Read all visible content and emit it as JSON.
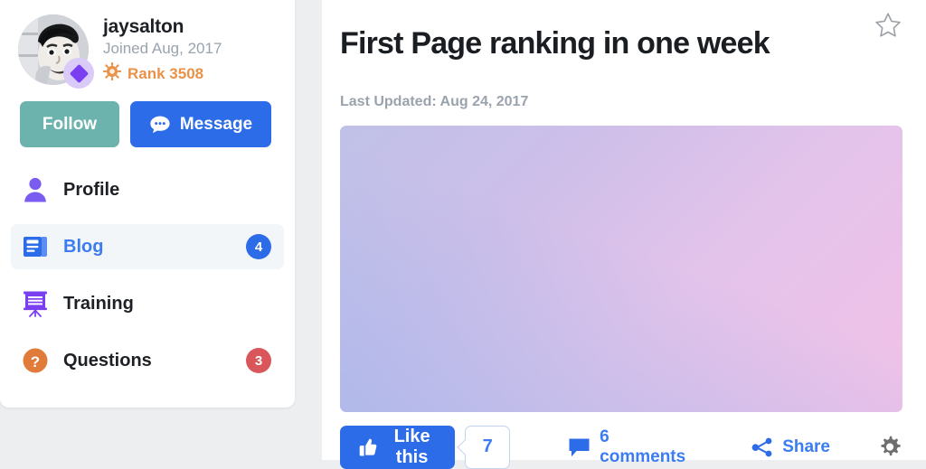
{
  "theme": {
    "page_bg": "#eceef0",
    "card_bg": "#ffffff",
    "accent_blue": "#2c6ce8",
    "link_blue": "#3b7cf0",
    "teal": "#6cb3ae",
    "orange": "#e8924a",
    "red": "#d9565a",
    "purple": "#7b3ff2",
    "muted_gray": "#9aa3ad"
  },
  "sidebar": {
    "profile": {
      "avatar_name": "user-avatar-photo",
      "rank_badge_icon": "diamond-icon",
      "username": "jaysalton",
      "joined": "Joined Aug, 2017",
      "rank_icon": "sun-icon",
      "rank": "Rank 3508"
    },
    "buttons": {
      "follow_label": "Follow",
      "message_label": "Message",
      "message_icon": "chat-bubble-icon"
    },
    "nav": [
      {
        "label": "Profile",
        "icon": "person-icon",
        "badge": "",
        "badge_color": "",
        "active": false
      },
      {
        "label": "Blog",
        "icon": "newspaper-icon",
        "badge": "4",
        "badge_color": "blue",
        "active": true
      },
      {
        "label": "Training",
        "icon": "presentation-icon",
        "badge": "",
        "badge_color": "",
        "active": false
      },
      {
        "label": "Questions",
        "icon": "question-mark-icon",
        "badge": "3",
        "badge_color": "red",
        "active": false
      }
    ]
  },
  "main": {
    "title": "First Page ranking in one week",
    "favorite_icon": "star-outline-icon",
    "last_updated": "Last Updated: Aug 24, 2017",
    "hero_image": {
      "name": "post-hero-image",
      "gradient_top_left": "#c0c1e8",
      "gradient_top_right": "#f2c2e8",
      "gradient_bottom_left": "#a8c0ee",
      "gradient_bottom_right": "#dcc0ea"
    },
    "actions": {
      "like_label": "Like this",
      "like_icon": "thumbs-up-icon",
      "like_count": "7",
      "comments_icon": "comment-bubble-icon",
      "comments_label": "6 comments",
      "share_icon": "share-icon",
      "share_label": "Share",
      "settings_icon": "gear-icon"
    }
  }
}
